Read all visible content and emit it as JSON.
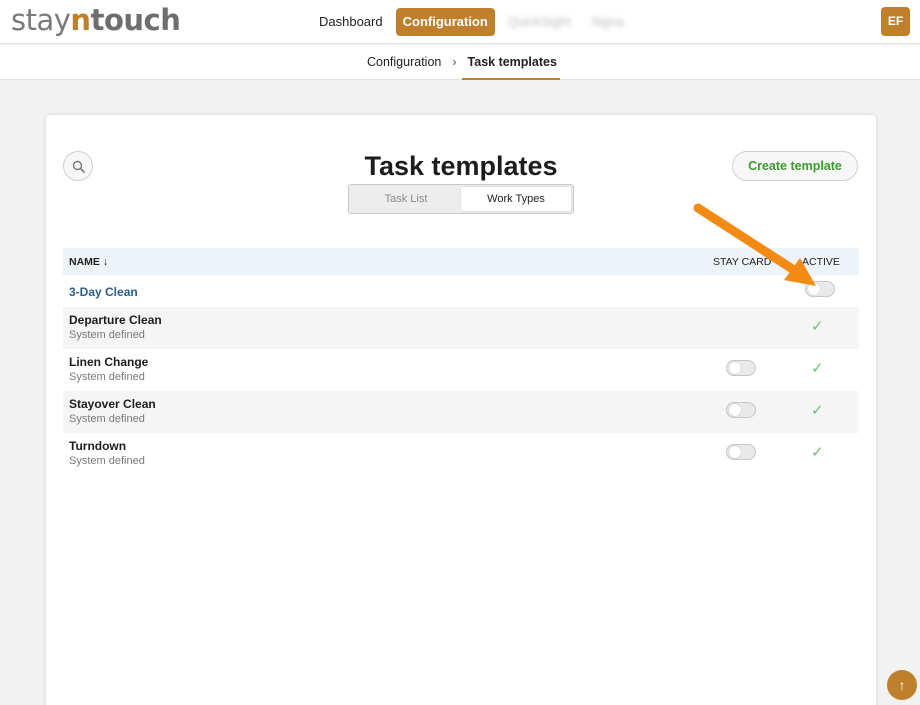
{
  "nav": {
    "logo": {
      "part1": "stay",
      "part2": "n",
      "part3": "touch"
    },
    "items": [
      {
        "label": "Dashboard",
        "active": false,
        "blurred": false
      },
      {
        "label": "Configuration",
        "active": true,
        "blurred": false
      },
      {
        "label": "QuickSight",
        "active": false,
        "blurred": true
      },
      {
        "label": "Signa",
        "active": false,
        "blurred": true
      }
    ],
    "avatar": "EF"
  },
  "breadcrumb": {
    "parent": "Configuration",
    "separator": "›",
    "current": "Task templates"
  },
  "page": {
    "title": "Task templates",
    "create_button": "Create template",
    "search_icon": "search-icon",
    "segments": [
      "Task List",
      "Work Types"
    ],
    "selected_segment": "Work Types"
  },
  "table": {
    "columns": {
      "name": "NAME ↓",
      "stay_card": "STAY CARD",
      "active": "ACTIVE"
    },
    "rows": [
      {
        "name": "3-Day Clean",
        "subtitle": "",
        "link": true,
        "stay_card_toggle": false,
        "active_toggle": true,
        "active_check": false
      },
      {
        "name": "Departure Clean",
        "subtitle": "System defined",
        "link": false,
        "stay_card_toggle": false,
        "active_toggle": false,
        "active_check": true
      },
      {
        "name": "Linen Change",
        "subtitle": "System defined",
        "link": false,
        "stay_card_toggle": true,
        "active_toggle": false,
        "active_check": true
      },
      {
        "name": "Stayover Clean",
        "subtitle": "System defined",
        "link": false,
        "stay_card_toggle": true,
        "active_toggle": false,
        "active_check": true
      },
      {
        "name": "Turndown",
        "subtitle": "System defined",
        "link": false,
        "stay_card_toggle": true,
        "active_toggle": false,
        "active_check": true
      }
    ],
    "check_glyph": "✓",
    "check_color": "#6cc06f"
  },
  "colors": {
    "brand": "#c07f2b",
    "link": "#2d5d8c",
    "create_text": "#3c9a2e",
    "arrow": "#f28a16"
  },
  "scroll_top_icon": "arrow-up-icon"
}
